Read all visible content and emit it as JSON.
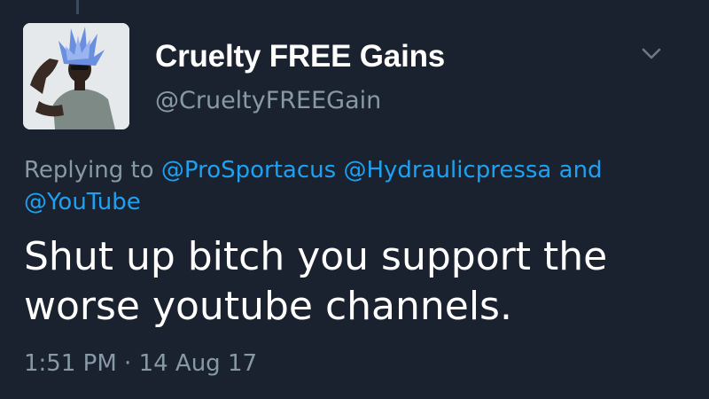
{
  "tweet": {
    "display_name": "Cruelty FREE Gains",
    "handle": "@CrueltyFREEGain",
    "avatar_icon": "user-avatar-photo",
    "menu_icon": "chevron-down-icon",
    "reply": {
      "prefix": "Replying to",
      "mention_1": "@ProSportacus",
      "mention_2": "@Hydraulicpressa",
      "joiner": "and",
      "mention_3": "@YouTube"
    },
    "text_line_1": "Shut up bitch you support the",
    "text_line_2": "worse youtube channels.",
    "time": "1:51 PM",
    "separator": "·",
    "date": "14 Aug 17"
  },
  "colors": {
    "background": "#1a2230",
    "primary_text": "#ffffff",
    "secondary_text": "#8899a6",
    "link": "#1da1f2"
  }
}
